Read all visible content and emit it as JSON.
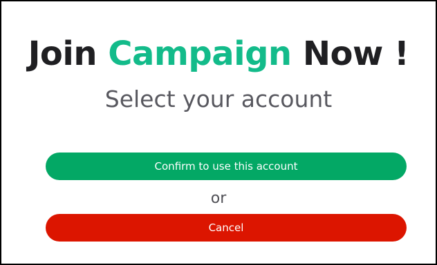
{
  "dialog": {
    "title": {
      "part1": "Join ",
      "accent": "Campaign",
      "part2": " Now !"
    },
    "subtitle": "Select your account",
    "confirm_label": "Confirm to use this account",
    "or_label": "or",
    "cancel_label": "Cancel"
  },
  "colors": {
    "accent_text": "#13bb8a",
    "title_text": "#1f1f22",
    "confirm_button": "#03a865",
    "cancel_button": "#dc1500",
    "border": "#000000"
  }
}
